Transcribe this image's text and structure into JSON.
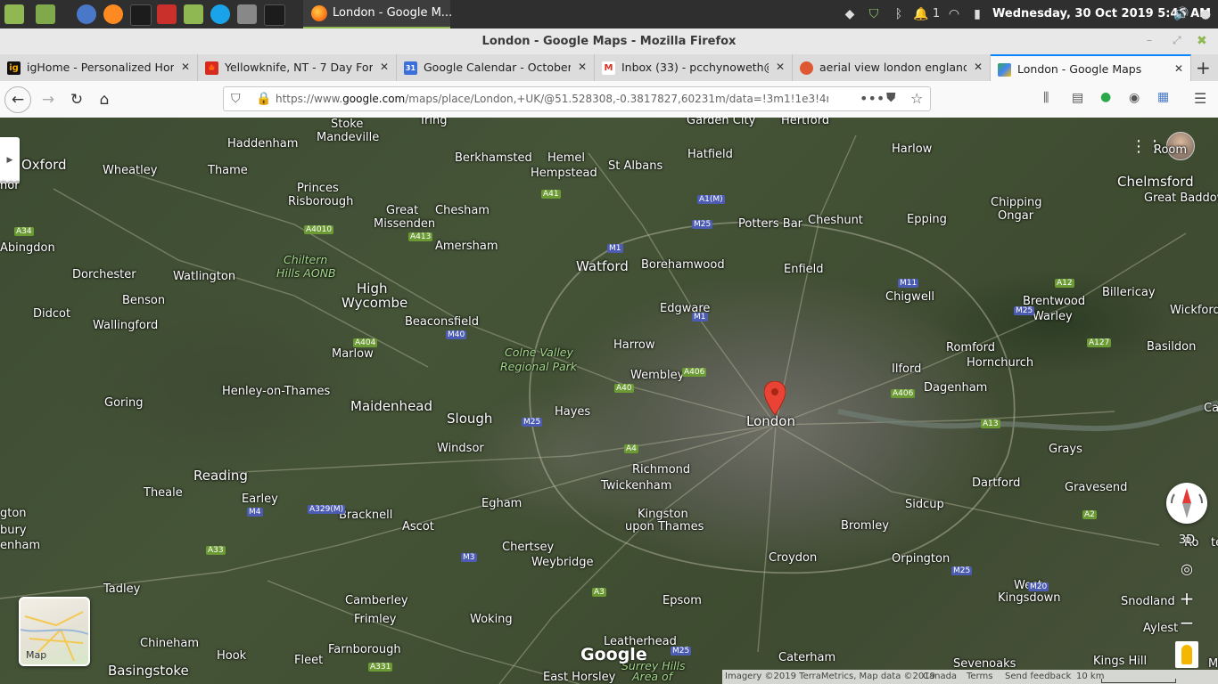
{
  "os_panel": {
    "task_title": "London - Google M...",
    "clock": "Wednesday, 30 Oct 2019  5:46 AM",
    "notification_count": "1"
  },
  "window": {
    "title": "London - Google Maps - Mozilla Firefox"
  },
  "tabs": [
    {
      "label": "igHome - Personalized Home",
      "favicon": "ig"
    },
    {
      "label": "Yellowknife, NT - 7 Day Forecast",
      "favicon": "canada-flag"
    },
    {
      "label": "Google Calendar - October 2019",
      "favicon": "31"
    },
    {
      "label": "Inbox (33) - pcchynoweth@gmail.com",
      "favicon": "M"
    },
    {
      "label": "aerial view london england at",
      "favicon": "duckduckgo"
    },
    {
      "label": "London - Google Maps",
      "favicon": "maps"
    }
  ],
  "nav": {
    "url_prefix": "https://www.",
    "url_domain": "google.com",
    "url_rest": "/maps/place/London,+UK/@51.528308,-0.3817827,60231m/data=!3m1!1e3!4m5!3m4!1s"
  },
  "map": {
    "places": [
      {
        "name": "Oxford",
        "cls": "big"
      },
      {
        "name": "Wheatley"
      },
      {
        "name": "Thame"
      },
      {
        "name": "Haddenham"
      },
      {
        "name": "Stoke"
      },
      {
        "name": "Mandeville"
      },
      {
        "name": "Tring"
      },
      {
        "name": "Berkhamsted"
      },
      {
        "name": "Hemel"
      },
      {
        "name": "Hempstead"
      },
      {
        "name": "St Albans"
      },
      {
        "name": "Garden City"
      },
      {
        "name": "Hertford"
      },
      {
        "name": "Hatfield"
      },
      {
        "name": "Harlow"
      },
      {
        "name": "Chelmsford",
        "cls": "big"
      },
      {
        "name": "Great Baddow"
      },
      {
        "name": "Chipping"
      },
      {
        "name": "Ongar"
      },
      {
        "name": "nor"
      },
      {
        "name": "Abingdon"
      },
      {
        "name": "Dorchester"
      },
      {
        "name": "Benson"
      },
      {
        "name": "Didcot"
      },
      {
        "name": "Wallingford"
      },
      {
        "name": "Watlington"
      },
      {
        "name": "Princes"
      },
      {
        "name": "Risborough"
      },
      {
        "name": "Chiltern",
        "cls": "park"
      },
      {
        "name": "Hills AONB",
        "cls": "park"
      },
      {
        "name": "Great"
      },
      {
        "name": "Missenden"
      },
      {
        "name": "Chesham"
      },
      {
        "name": "Amersham"
      },
      {
        "name": "High",
        "cls": "big"
      },
      {
        "name": "Wycombe",
        "cls": "big"
      },
      {
        "name": "Watford",
        "cls": "big"
      },
      {
        "name": "Borehamwood"
      },
      {
        "name": "Potters Bar"
      },
      {
        "name": "Cheshunt"
      },
      {
        "name": "Epping"
      },
      {
        "name": "Enfield"
      },
      {
        "name": "Chigwell"
      },
      {
        "name": "Brentwood"
      },
      {
        "name": "Warley"
      },
      {
        "name": "Billericay"
      },
      {
        "name": "Wickford"
      },
      {
        "name": "Basildon"
      },
      {
        "name": "Edgware"
      },
      {
        "name": "Beaconsfield"
      },
      {
        "name": "Marlow"
      },
      {
        "name": "Colne Valley",
        "cls": "park"
      },
      {
        "name": "Regional Park",
        "cls": "park"
      },
      {
        "name": "Harrow"
      },
      {
        "name": "Wembley"
      },
      {
        "name": "Romford"
      },
      {
        "name": "Hornchurch"
      },
      {
        "name": "Ilford"
      },
      {
        "name": "Dagenham"
      },
      {
        "name": "Goring"
      },
      {
        "name": "Henley-on-Thames"
      },
      {
        "name": "Maidenhead",
        "cls": "big"
      },
      {
        "name": "Slough",
        "cls": "big"
      },
      {
        "name": "Hayes"
      },
      {
        "name": "London",
        "cls": "big"
      },
      {
        "name": "Grays"
      },
      {
        "name": "Canv"
      },
      {
        "name": "Windsor"
      },
      {
        "name": "Richmond"
      },
      {
        "name": "Twickenham"
      },
      {
        "name": "Dartford"
      },
      {
        "name": "Gravesend"
      },
      {
        "name": "Reading",
        "cls": "big"
      },
      {
        "name": "Theale"
      },
      {
        "name": "Earley"
      },
      {
        "name": "Bracknell"
      },
      {
        "name": "Ascot"
      },
      {
        "name": "Egham"
      },
      {
        "name": "Kingston"
      },
      {
        "name": "upon Thames"
      },
      {
        "name": "Sidcup"
      },
      {
        "name": "Bromley"
      },
      {
        "name": "gton"
      },
      {
        "name": "bury"
      },
      {
        "name": "enham"
      },
      {
        "name": "Chertsey"
      },
      {
        "name": "Weybridge"
      },
      {
        "name": "Croydon"
      },
      {
        "name": "Orpington"
      },
      {
        "name": "Ro"
      },
      {
        "name": "ter"
      },
      {
        "name": "Tadley"
      },
      {
        "name": "Camberley"
      },
      {
        "name": "Frimley"
      },
      {
        "name": "Woking"
      },
      {
        "name": "Epsom"
      },
      {
        "name": "West"
      },
      {
        "name": "Kingsdown"
      },
      {
        "name": "Snodland"
      },
      {
        "name": "Aylest"
      },
      {
        "name": "Chineham"
      },
      {
        "name": "Hook"
      },
      {
        "name": "Farnborough"
      },
      {
        "name": "Fleet"
      },
      {
        "name": "Leatherhead"
      },
      {
        "name": "Surrey Hills",
        "cls": "park"
      },
      {
        "name": "Area of",
        "cls": "park"
      },
      {
        "name": "Caterham"
      },
      {
        "name": "Sevenoaks"
      },
      {
        "name": "Kings Hill"
      },
      {
        "name": "Maidsto"
      },
      {
        "name": "Basingstoke",
        "cls": "big"
      },
      {
        "name": "East Horsley"
      },
      {
        "name": "Room"
      }
    ],
    "roads": [
      {
        "label": "A41",
        "color": "g"
      },
      {
        "label": "A1(M)",
        "color": "b"
      },
      {
        "label": "M25",
        "color": "b"
      },
      {
        "label": "M1",
        "color": "b"
      },
      {
        "label": "A4010",
        "color": "g"
      },
      {
        "label": "A413",
        "color": "g"
      },
      {
        "label": "A34",
        "color": "g"
      },
      {
        "label": "M11",
        "color": "b"
      },
      {
        "label": "A12",
        "color": "g"
      },
      {
        "label": "M25",
        "color": "b"
      },
      {
        "label": "M1",
        "color": "b"
      },
      {
        "label": "M40",
        "color": "b"
      },
      {
        "label": "A404",
        "color": "g"
      },
      {
        "label": "A127",
        "color": "g"
      },
      {
        "label": "A406",
        "color": "g"
      },
      {
        "label": "A40",
        "color": "g"
      },
      {
        "label": "A406",
        "color": "g"
      },
      {
        "label": "M25",
        "color": "b"
      },
      {
        "label": "A13",
        "color": "g"
      },
      {
        "label": "A4",
        "color": "g"
      },
      {
        "label": "M4",
        "color": "b"
      },
      {
        "label": "A329(M)",
        "color": "b"
      },
      {
        "label": "A2",
        "color": "g"
      },
      {
        "label": "A33",
        "color": "g"
      },
      {
        "label": "M3",
        "color": "b"
      },
      {
        "label": "M25",
        "color": "b"
      },
      {
        "label": "M20",
        "color": "b"
      },
      {
        "label": "A3",
        "color": "g"
      },
      {
        "label": "M25",
        "color": "b"
      },
      {
        "label": "A331",
        "color": "g"
      }
    ],
    "layer_label": "Map",
    "google_logo": "Google",
    "footer": {
      "imagery": "Imagery ©2019 TerraMetrics, Map data ©2019",
      "region": "Canada",
      "terms": "Terms",
      "feedback": "Send feedback",
      "scale": "10 km"
    },
    "threed_label": "3D"
  }
}
